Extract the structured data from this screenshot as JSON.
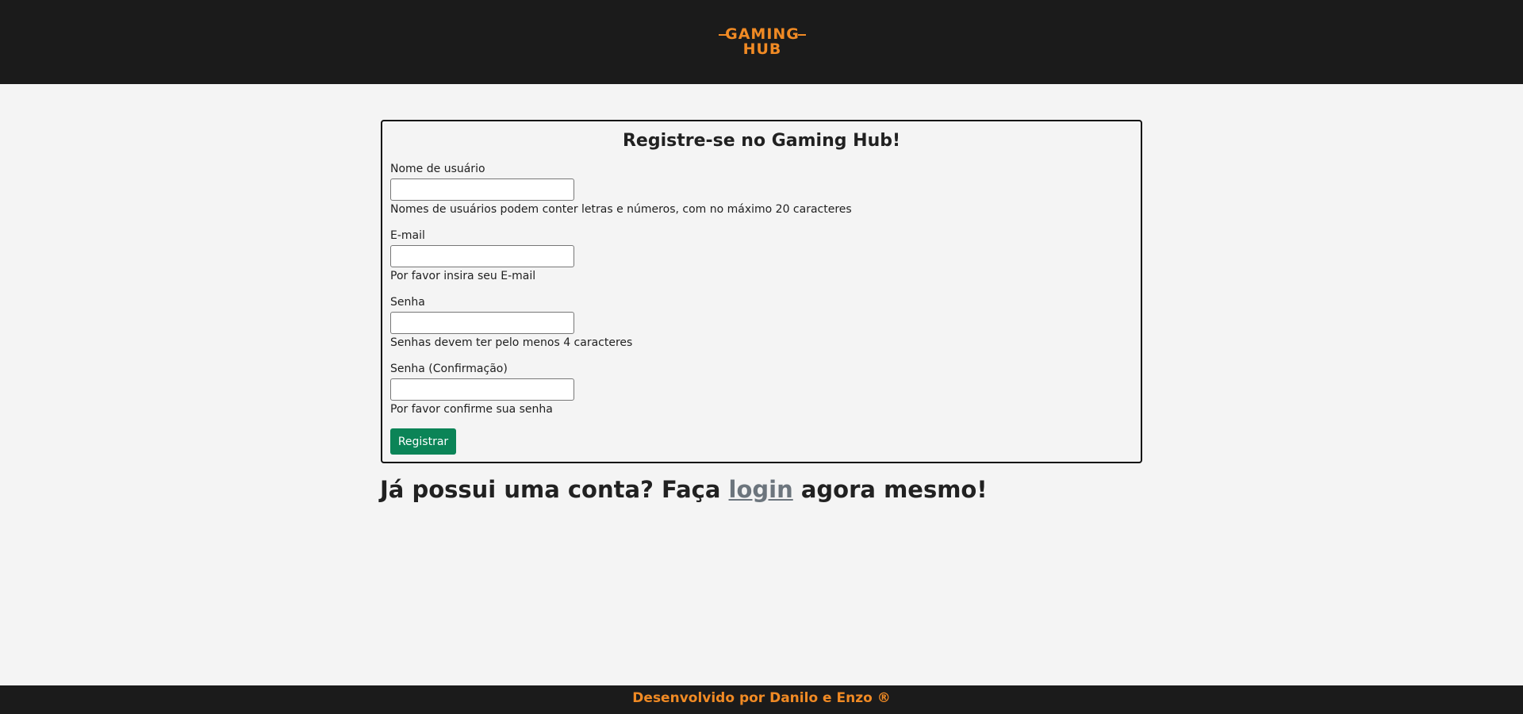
{
  "header": {
    "logo_line1": "GAMING",
    "logo_line2": "HUB"
  },
  "form": {
    "title": "Registre-se no Gaming Hub!",
    "fields": [
      {
        "label": "Nome de usuário",
        "value": "",
        "help": "Nomes de usuários podem conter letras e números, com no máximo 20 caracteres"
      },
      {
        "label": "E-mail",
        "value": "",
        "help": "Por favor insira seu E-mail"
      },
      {
        "label": "Senha",
        "value": "",
        "help": "Senhas devem ter pelo menos 4 caracteres"
      },
      {
        "label": "Senha (Confirmação)",
        "value": "",
        "help": "Por favor confirme sua senha"
      }
    ],
    "submit_label": "Registrar"
  },
  "login_prompt": {
    "before": "Já possui uma conta? Faça ",
    "link": "login",
    "after": " agora mesmo!"
  },
  "footer": {
    "text": "Desenvolvido por Danilo e Enzo ®"
  },
  "colors": {
    "brand_orange": "#f08a24",
    "header_bg": "#1b1b1b",
    "button_green": "#0b8457",
    "page_bg": "#f4f4f4"
  }
}
